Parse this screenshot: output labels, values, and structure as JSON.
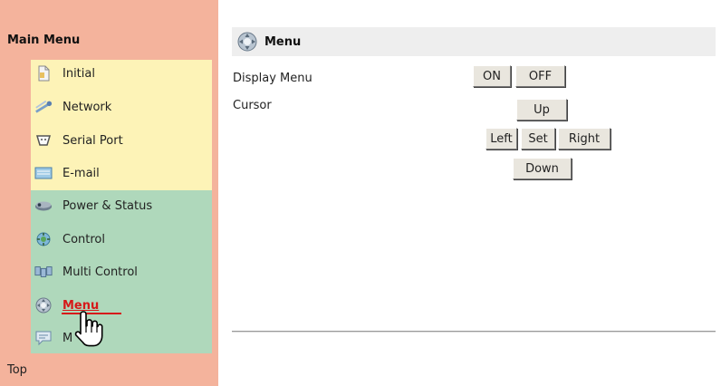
{
  "sidebar": {
    "title": "Main Menu",
    "items": [
      {
        "label": "Initial",
        "icon": "document-icon"
      },
      {
        "label": "Network",
        "icon": "network-icon"
      },
      {
        "label": "Serial Port",
        "icon": "serial-port-icon"
      },
      {
        "label": "E-mail",
        "icon": "email-icon"
      },
      {
        "label": "Power & Status",
        "icon": "power-icon"
      },
      {
        "label": "Control",
        "icon": "control-icon"
      },
      {
        "label": "Multi Control",
        "icon": "multi-control-icon"
      },
      {
        "label": "Menu",
        "icon": "menu-icon",
        "active": true
      },
      {
        "label": "M",
        "icon": "message-icon"
      }
    ],
    "top_link": "Top"
  },
  "main": {
    "title": "Menu",
    "display_menu_label": "Display Menu",
    "cursor_label": "Cursor",
    "buttons": {
      "on": "ON",
      "off": "OFF",
      "up": "Up",
      "left": "Left",
      "set": "Set",
      "right": "Right",
      "down": "Down"
    }
  },
  "colors": {
    "sidebar_bg": "#f4b39c",
    "group_yellow": "#fdf3b7",
    "group_green": "#afd8bb",
    "active_text": "#d61a1a",
    "header_bg": "#eeeeee"
  }
}
